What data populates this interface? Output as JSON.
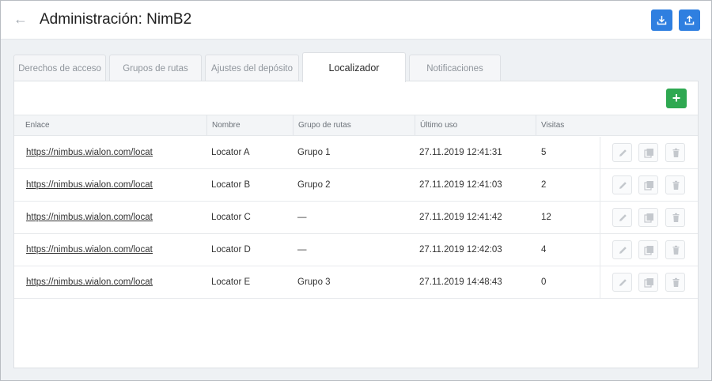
{
  "header": {
    "title": "Administración: NimB2",
    "back_icon": "arrow-left-icon",
    "download_icon": "download-icon",
    "upload_icon": "upload-icon"
  },
  "tabs": [
    {
      "label": "Derechos de acceso",
      "active": false
    },
    {
      "label": "Grupos de rutas",
      "active": false
    },
    {
      "label": "Ajustes del depósito",
      "active": false
    },
    {
      "label": "Localizador",
      "active": true
    },
    {
      "label": "Notificaciones",
      "active": false
    }
  ],
  "panel": {
    "add_label": "+"
  },
  "table": {
    "columns": [
      "Enlace",
      "Nombre",
      "Grupo de rutas",
      "Último uso",
      "Visitas"
    ],
    "rows": [
      {
        "link": "https://nimbus.wialon.com/locator/",
        "name": "Locator A",
        "group": "Grupo 1",
        "last_used": "27.11.2019 12:41:31",
        "visits": "5"
      },
      {
        "link": "https://nimbus.wialon.com/locator/",
        "name": "Locator B",
        "group": "Grupo 2",
        "last_used": "27.11.2019 12:41:03",
        "visits": "2"
      },
      {
        "link": "https://nimbus.wialon.com/locator/",
        "name": "Locator C",
        "group": "—",
        "last_used": "27.11.2019 12:41:42",
        "visits": "12"
      },
      {
        "link": "https://nimbus.wialon.com/locator/",
        "name": "Locator D",
        "group": "—",
        "last_used": "27.11.2019 12:42:03",
        "visits": "4"
      },
      {
        "link": "https://nimbus.wialon.com/locator/",
        "name": "Locator E",
        "group": "Grupo 3",
        "last_used": "27.11.2019 14:48:43",
        "visits": "0"
      }
    ],
    "row_action_icons": [
      "pencil-icon",
      "copy-icon",
      "trash-icon"
    ]
  },
  "colors": {
    "accent_blue": "#2f7fe0",
    "add_green": "#2ea851"
  }
}
